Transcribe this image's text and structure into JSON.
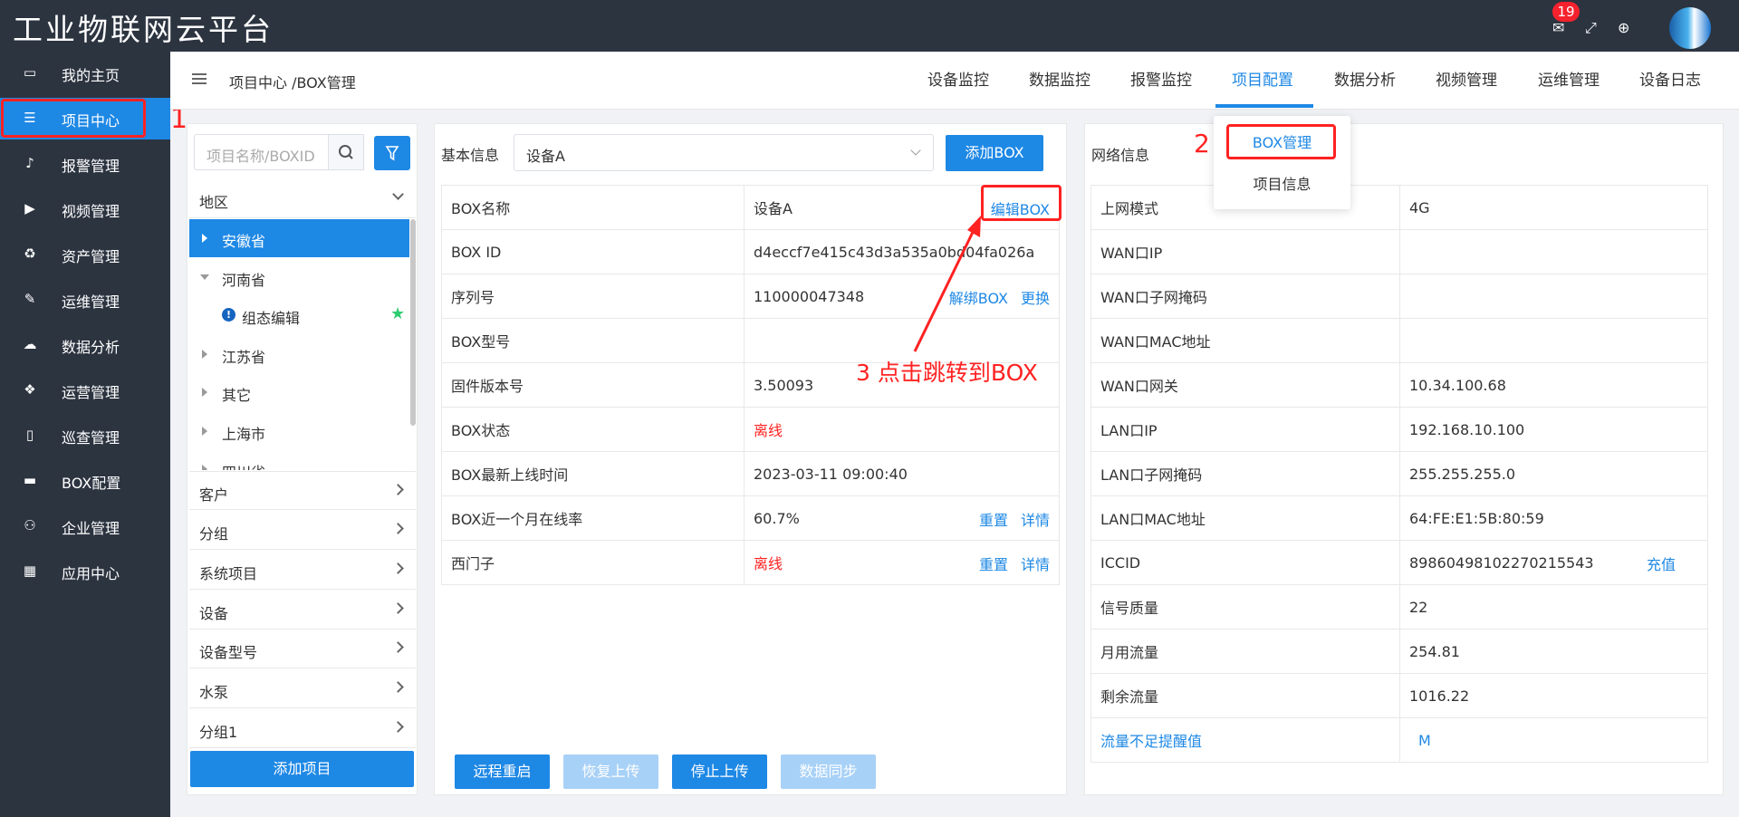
{
  "app": {
    "title": "工业物联网云平台",
    "notification_count": "19"
  },
  "sidebar": {
    "items": [
      {
        "label": "我的主页",
        "icon": "laptop-icon"
      },
      {
        "label": "项目中心",
        "icon": "table-list-icon"
      },
      {
        "label": "报警管理",
        "icon": "bell-icon"
      },
      {
        "label": "视频管理",
        "icon": "video-camera-icon"
      },
      {
        "label": "资产管理",
        "icon": "recycle-icon"
      },
      {
        "label": "运维管理",
        "icon": "wrench-icon"
      },
      {
        "label": "数据分析",
        "icon": "cloud-chart-icon"
      },
      {
        "label": "运营管理",
        "icon": "cubes-icon"
      },
      {
        "label": "巡查管理",
        "icon": "document-icon"
      },
      {
        "label": "BOX配置",
        "icon": "monitor-icon"
      },
      {
        "label": "企业管理",
        "icon": "org-chart-icon"
      },
      {
        "label": "应用中心",
        "icon": "apps-grid-icon"
      }
    ],
    "active_index": 1
  },
  "header": {
    "breadcrumb": "项目中心 /BOX管理",
    "tabs": [
      "设备监控",
      "数据监控",
      "报警监控",
      "项目配置",
      "数据分析",
      "视频管理",
      "运维管理",
      "设备日志"
    ],
    "active_tab": 3
  },
  "dropdown": {
    "items": [
      "BOX管理",
      "项目信息"
    ],
    "selected": 0
  },
  "left_panel": {
    "search_placeholder": "项目名称/BOXID",
    "region_label": "地区",
    "tree": [
      {
        "label": "安徽省",
        "expanded": false,
        "selected": true
      },
      {
        "label": "河南省",
        "expanded": true,
        "selected": false
      },
      {
        "label": "组态编辑",
        "child": true
      },
      {
        "label": "江苏省",
        "expanded": false
      },
      {
        "label": "其它",
        "expanded": false
      },
      {
        "label": "上海市",
        "expanded": false
      },
      {
        "label": "四川省",
        "expanded": false
      }
    ],
    "groups": [
      "客户",
      "分组",
      "系统项目",
      "设备",
      "设备型号",
      "水泵",
      "分组1"
    ],
    "add_button": "添加项目"
  },
  "basic_info": {
    "label": "基本信息",
    "selected_device": "设备A",
    "add_box_button": "添加BOX",
    "rows": [
      {
        "key": "BOX名称",
        "value": "设备A",
        "actions": [
          "编辑BOX"
        ]
      },
      {
        "key": "BOX ID",
        "value": "d4eccf7e415c43d3a535a0bd04fa026a",
        "actions": []
      },
      {
        "key": "序列号",
        "value": "110000047348",
        "actions": [
          "解绑BOX",
          "更换"
        ]
      },
      {
        "key": "BOX型号",
        "value": "",
        "actions": []
      },
      {
        "key": "固件版本号",
        "value": "3.50093",
        "actions": []
      },
      {
        "key": "BOX状态",
        "value": "离线",
        "actions": []
      },
      {
        "key": "BOX最新上线时间",
        "value": "2023-03-11 09:00:40",
        "actions": []
      },
      {
        "key": "BOX近一个月在线率",
        "value": "60.7%",
        "actions": [
          "重置",
          "详情"
        ]
      },
      {
        "key": "西门子",
        "value": "离线",
        "actions": [
          "重置",
          "详情"
        ]
      }
    ],
    "bottom_buttons": [
      {
        "label": "远程重启",
        "enabled": true
      },
      {
        "label": "恢复上传",
        "enabled": false
      },
      {
        "label": "停止上传",
        "enabled": true
      },
      {
        "label": "数据同步",
        "enabled": false
      }
    ]
  },
  "network_info": {
    "label": "网络信息",
    "rows": [
      {
        "key": "上网模式",
        "value": "4G"
      },
      {
        "key": "WAN口IP",
        "value": ""
      },
      {
        "key": "WAN口子网掩码",
        "value": ""
      },
      {
        "key": "WAN口MAC地址",
        "value": ""
      },
      {
        "key": "WAN口网关",
        "value": "10.34.100.68"
      },
      {
        "key": "LAN口IP",
        "value": "192.168.10.100"
      },
      {
        "key": "LAN口子网掩码",
        "value": "255.255.255.0"
      },
      {
        "key": "LAN口MAC地址",
        "value": "64:FE:E1:5B:80:59"
      },
      {
        "key": "ICCID",
        "value": "89860498102270215543",
        "action": "充值"
      },
      {
        "key": "信号质量",
        "value": "22"
      },
      {
        "key": "月用流量",
        "value": "254.81"
      },
      {
        "key": "剩余流量",
        "value": "1016.22"
      },
      {
        "key": "流量不足提醒值",
        "value": "M",
        "link": true
      }
    ]
  },
  "annotations": {
    "n1": "1",
    "n2": "2",
    "n3": "3 点击跳转到BOX"
  },
  "colors": {
    "primary": "#1e88e5",
    "sidebar": "#2c3440",
    "highlight": "#ff2222"
  }
}
